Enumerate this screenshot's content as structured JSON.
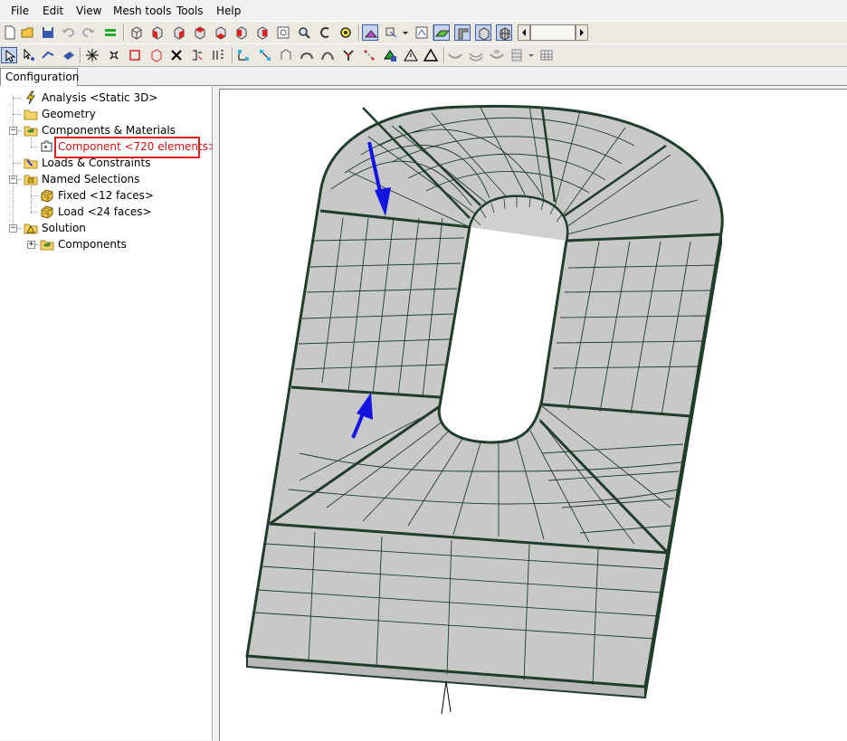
{
  "menubar": {
    "items": [
      "File",
      "Edit",
      "View",
      "Mesh tools",
      "Tools",
      "Help"
    ]
  },
  "tabs": {
    "configuration": "Configuration"
  },
  "tree": {
    "analysis": "Analysis <Static 3D>",
    "geometry": "Geometry",
    "components_materials": "Components & Materials",
    "component": "Component <720 elements>",
    "loads_constraints": "Loads & Constraints",
    "named_selections": "Named Selections",
    "fixed": "Fixed <12 faces>",
    "load": "Load <24 faces>",
    "solution": "Solution",
    "components": "Components"
  },
  "colors": {
    "mesh_fill": "#c8c8c8",
    "mesh_edge": "#1f3d2a",
    "load_arrow": "#1414e0",
    "highlight": "#e11b1b",
    "selected_text": "#d01010"
  }
}
